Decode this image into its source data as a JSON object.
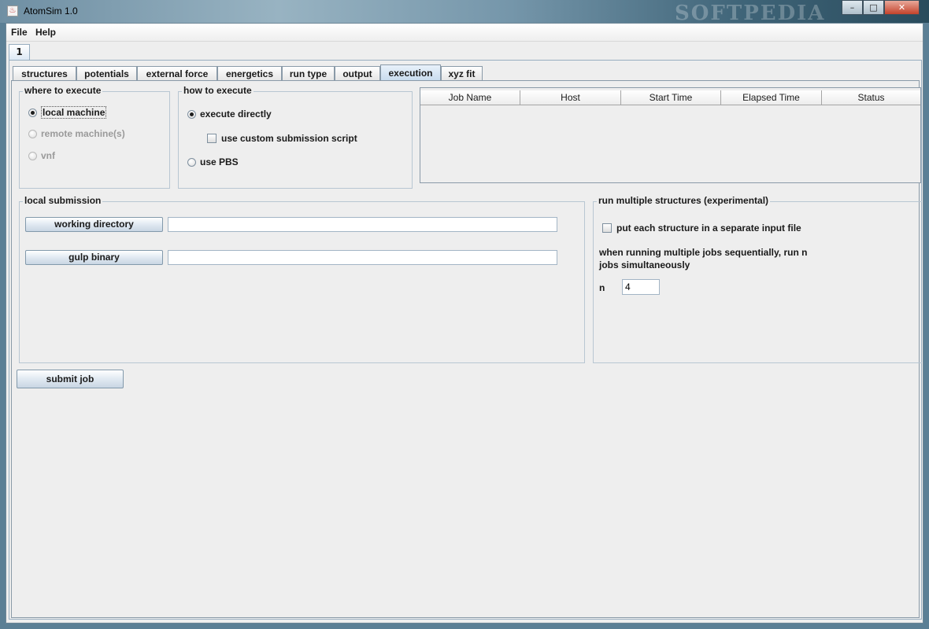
{
  "window": {
    "title": "AtomSim 1.0",
    "icon": "java-app-icon",
    "controls": {
      "minimize": "–",
      "maximize": "□",
      "close": "✕"
    }
  },
  "watermark": "SOFTPEDIA",
  "menubar": {
    "items": [
      "File",
      "Help"
    ]
  },
  "outer_tab": {
    "label": "1"
  },
  "tabs": [
    {
      "label": "structures",
      "selected": false
    },
    {
      "label": "potentials",
      "selected": false
    },
    {
      "label": "external force",
      "selected": false
    },
    {
      "label": "energetics",
      "selected": false
    },
    {
      "label": "run type",
      "selected": false
    },
    {
      "label": "output",
      "selected": false
    },
    {
      "label": "execution",
      "selected": true
    },
    {
      "label": "xyz fit",
      "selected": false
    }
  ],
  "where_to_execute": {
    "title": "where to execute",
    "options": [
      {
        "label": "local machine",
        "selected": true,
        "enabled": true
      },
      {
        "label": "remote machine(s)",
        "selected": false,
        "enabled": false
      },
      {
        "label": "vnf",
        "selected": false,
        "enabled": false
      }
    ]
  },
  "how_to_execute": {
    "title": "how to execute",
    "execute_directly": "execute directly",
    "custom_script": "use custom submission script",
    "use_pbs": "use PBS"
  },
  "jobs_table": {
    "columns": [
      "Job Name",
      "Host",
      "Start Time",
      "Elapsed Time",
      "Status"
    ],
    "rows": []
  },
  "local_submission": {
    "title": "local submission",
    "working_directory_button": "working directory",
    "working_directory_value": "",
    "gulp_binary_button": "gulp binary",
    "gulp_binary_value": ""
  },
  "multiple_structures": {
    "title": "run multiple structures (experimental)",
    "separate_file_label": "put each structure in a separate input file",
    "sequential_text": "when running multiple jobs sequentially, run n jobs simultaneously",
    "n_label": "n",
    "n_value": "4"
  },
  "submit_button": "submit job",
  "colors": {
    "selected_tab": "#c8dbee",
    "panel_bg": "#eeeeee",
    "group_border": "#b8c6d2"
  }
}
